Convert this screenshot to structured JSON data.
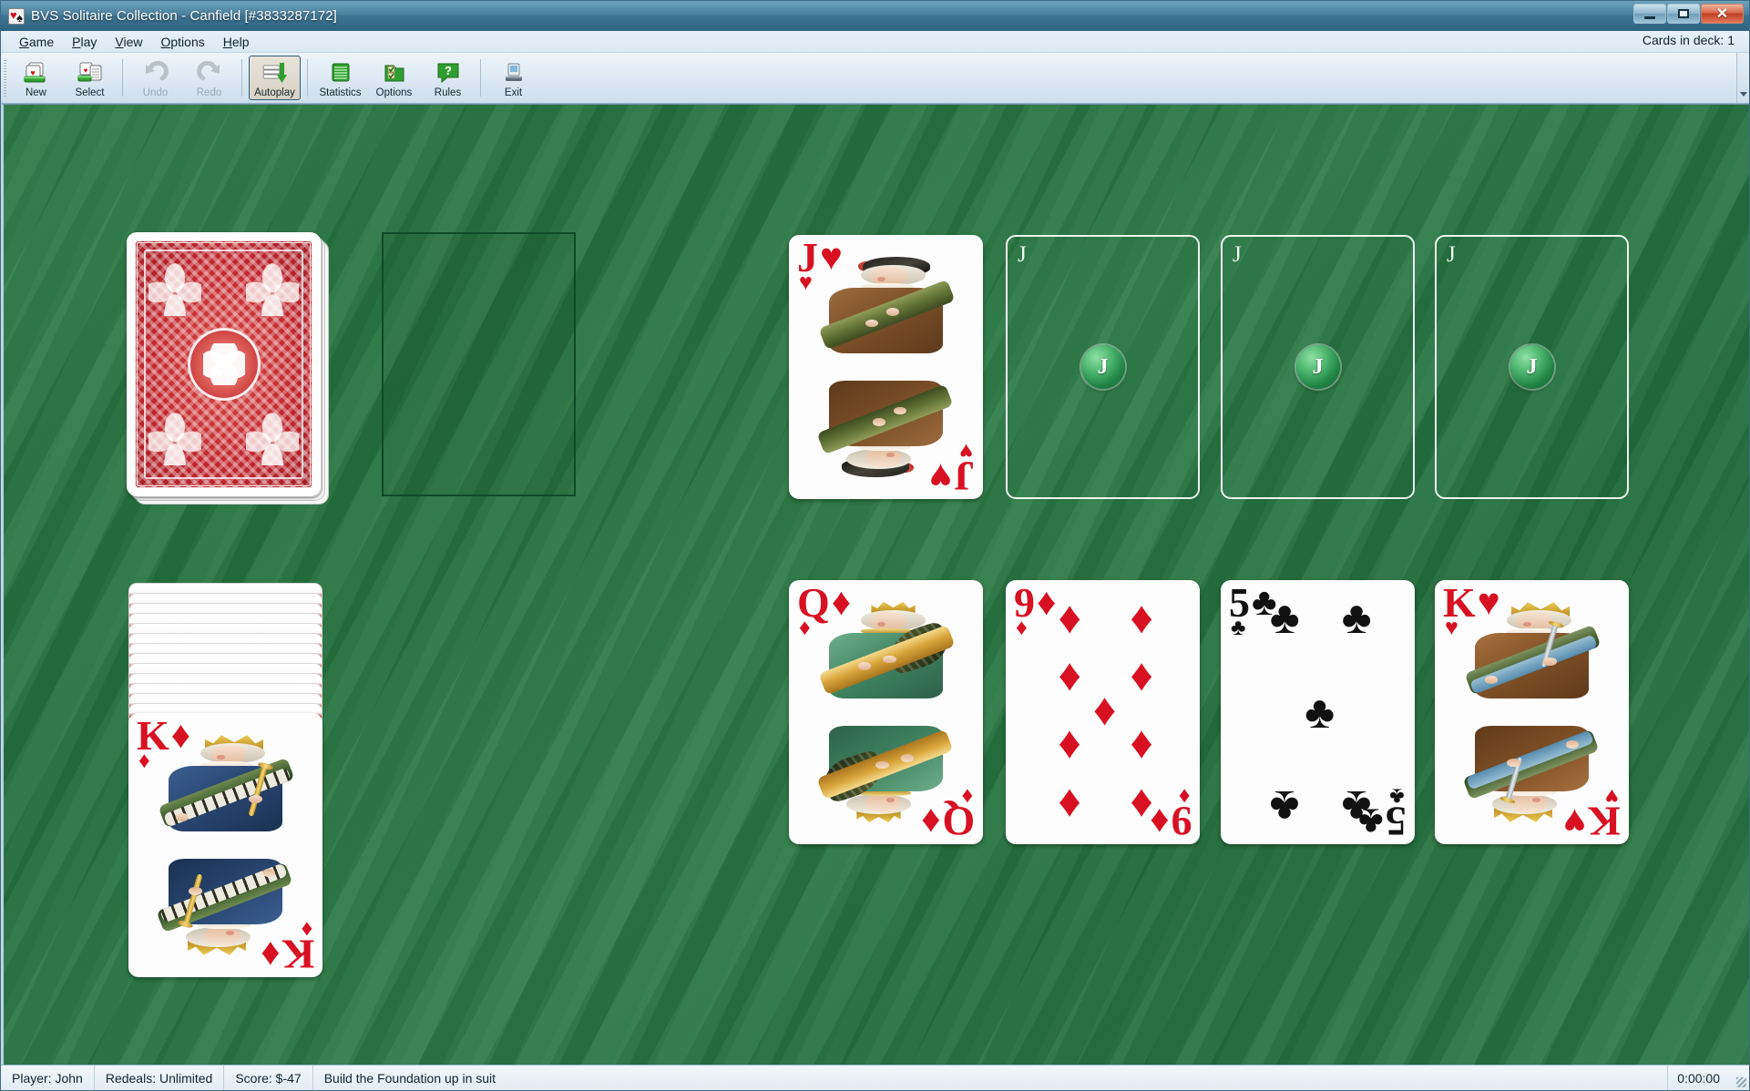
{
  "window": {
    "title": "BVS Solitaire Collection  -  Canfield [#3833287172]",
    "icon": "cards-icon",
    "minimize_label": "–",
    "maximize_label": "□",
    "close_label": "✕"
  },
  "menu": {
    "items": [
      {
        "label": "Game",
        "accel": "G"
      },
      {
        "label": "Play",
        "accel": "P"
      },
      {
        "label": "View",
        "accel": "V"
      },
      {
        "label": "Options",
        "accel": "O"
      },
      {
        "label": "Help",
        "accel": "H"
      }
    ],
    "deck_counter": "Cards in deck:  1"
  },
  "toolbar": {
    "buttons": [
      {
        "label": "New",
        "icon": "new-game-icon",
        "state": "enabled"
      },
      {
        "label": "Select",
        "icon": "select-game-icon",
        "state": "enabled"
      },
      {
        "label": "Undo",
        "icon": "undo-icon",
        "state": "disabled"
      },
      {
        "label": "Redo",
        "icon": "redo-icon",
        "state": "disabled"
      },
      {
        "label": "Autoplay",
        "icon": "autoplay-icon",
        "state": "active"
      },
      {
        "label": "Statistics",
        "icon": "statistics-icon",
        "state": "enabled"
      },
      {
        "label": "Options",
        "icon": "options-icon",
        "state": "enabled"
      },
      {
        "label": "Rules",
        "icon": "rules-icon",
        "state": "enabled"
      },
      {
        "label": "Exit",
        "icon": "exit-icon",
        "state": "enabled"
      }
    ],
    "overflow_label": "▾"
  },
  "table": {
    "felt_color": "#2a7644",
    "stock": {
      "name": "stock-pile",
      "card_back_color": "#c0272d",
      "card_count": 1
    },
    "waste": {
      "name": "waste-pile",
      "empty": true
    },
    "reserve": {
      "name": "reserve-pile",
      "facedown_count": 13,
      "top_card": {
        "rank": "K",
        "suit": "♦",
        "suit_name": "diamonds",
        "color": "red"
      }
    },
    "foundations": [
      {
        "rank": "J",
        "suit": "♥",
        "suit_name": "hearts",
        "color": "red",
        "empty": false
      },
      {
        "rank": "J",
        "suit": "",
        "suit_name": "",
        "color": "",
        "empty": true
      },
      {
        "rank": "J",
        "suit": "",
        "suit_name": "",
        "color": "",
        "empty": true
      },
      {
        "rank": "J",
        "suit": "",
        "suit_name": "",
        "color": "",
        "empty": true
      }
    ],
    "tableau": [
      {
        "rank": "Q",
        "suit": "♦",
        "suit_name": "diamonds",
        "color": "red",
        "type": "court"
      },
      {
        "rank": "9",
        "suit": "♦",
        "suit_name": "diamonds",
        "color": "red",
        "type": "pip"
      },
      {
        "rank": "5",
        "suit": "♣",
        "suit_name": "clubs",
        "color": "black",
        "type": "pip"
      },
      {
        "rank": "K",
        "suit": "♥",
        "suit_name": "hearts",
        "color": "red",
        "type": "court"
      }
    ]
  },
  "statusbar": {
    "player": "Player: John",
    "redeals": "Redeals: Unlimited",
    "score": "Score: $-47",
    "hint": "Build the Foundation up in suit",
    "time": "0:00:00"
  }
}
